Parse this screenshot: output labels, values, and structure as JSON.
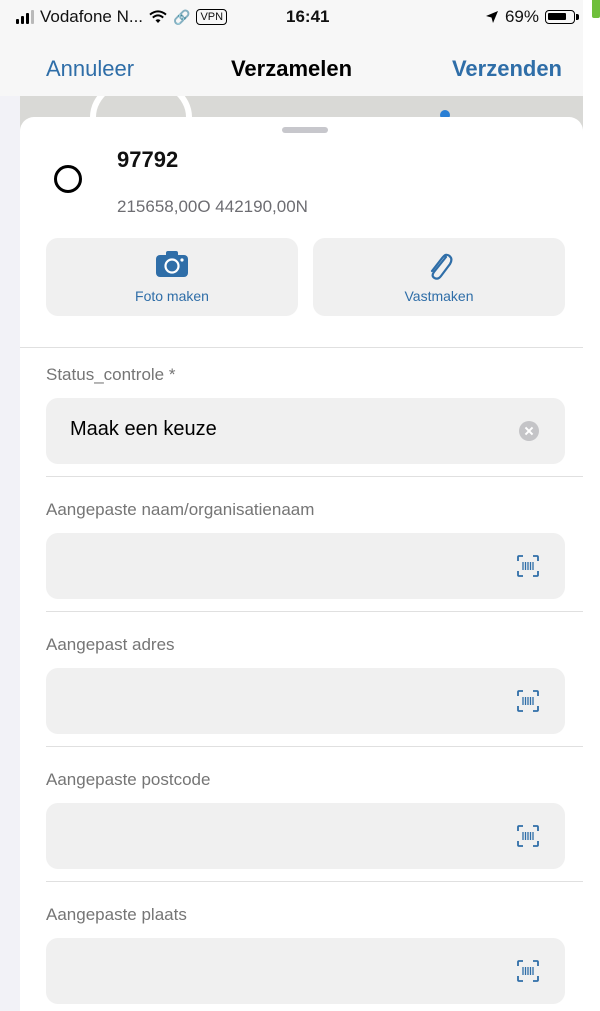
{
  "status_bar": {
    "carrier": "Vodafone N...",
    "vpn_label": "VPN",
    "time": "16:41",
    "battery_pct": "69%",
    "icons": [
      "signal-icon",
      "wifi-icon",
      "hotspot-icon",
      "location-arrow-icon",
      "battery-icon"
    ]
  },
  "nav": {
    "cancel_label": "Annuleer",
    "title": "Verzamelen",
    "send_label": "Verzenden"
  },
  "point": {
    "title": "97792",
    "coords": "215658,00O 442190,00N"
  },
  "actions": [
    {
      "label": "Foto maken",
      "icon": "camera-icon"
    },
    {
      "label": "Vastmaken",
      "icon": "paperclip-icon"
    }
  ],
  "form": {
    "fields": [
      {
        "label": "Status_controle *",
        "value": "Maak een keuze",
        "action_icon": "clear-icon"
      },
      {
        "label": "Aangepaste naam/organisatienaam",
        "value": "",
        "action_icon": "barcode-scan-icon"
      },
      {
        "label": "Aangepast adres",
        "value": "",
        "action_icon": "barcode-scan-icon"
      },
      {
        "label": "Aangepaste postcode",
        "value": "",
        "action_icon": "barcode-scan-icon"
      },
      {
        "label": "Aangepaste plaats",
        "value": "",
        "action_icon": "barcode-scan-icon"
      }
    ]
  },
  "colors": {
    "accent": "#2f6ea8",
    "field_bg": "#f0f0f0",
    "label_gray": "#757575"
  }
}
